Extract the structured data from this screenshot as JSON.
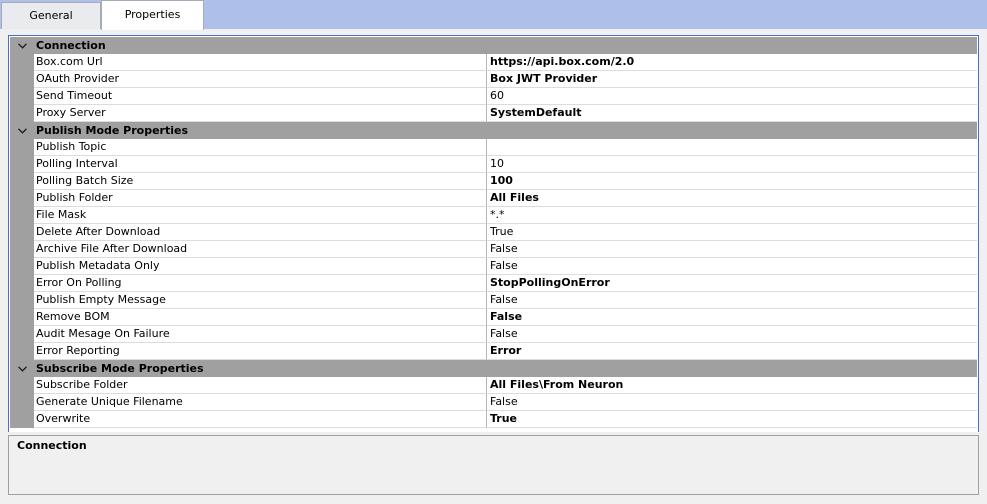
{
  "tabs": [
    {
      "label": "General",
      "active": false
    },
    {
      "label": "Properties",
      "active": true
    }
  ],
  "categories": [
    {
      "name": "Connection",
      "expanded": true,
      "properties": [
        {
          "name": "Box.com Url",
          "value": "https://api.box.com/2.0",
          "bold": true
        },
        {
          "name": "OAuth Provider",
          "value": "Box JWT Provider",
          "bold": true
        },
        {
          "name": "Send Timeout",
          "value": "60",
          "bold": false
        },
        {
          "name": "Proxy Server",
          "value": "SystemDefault",
          "bold": true
        }
      ]
    },
    {
      "name": "Publish Mode Properties",
      "expanded": true,
      "properties": [
        {
          "name": "Publish Topic",
          "value": "",
          "bold": false
        },
        {
          "name": "Polling Interval",
          "value": "10",
          "bold": false
        },
        {
          "name": "Polling Batch Size",
          "value": "100",
          "bold": true
        },
        {
          "name": "Publish Folder",
          "value": "All Files",
          "bold": true
        },
        {
          "name": "File Mask",
          "value": "*.*",
          "bold": false
        },
        {
          "name": "Delete After Download",
          "value": "True",
          "bold": false
        },
        {
          "name": "Archive File After Download",
          "value": "False",
          "bold": false
        },
        {
          "name": "Publish Metadata Only",
          "value": "False",
          "bold": false
        },
        {
          "name": "Error On Polling",
          "value": "StopPollingOnError",
          "bold": true
        },
        {
          "name": "Publish Empty Message",
          "value": "False",
          "bold": false
        },
        {
          "name": "Remove BOM",
          "value": "False",
          "bold": true
        },
        {
          "name": "Audit Mesage On Failure",
          "value": "False",
          "bold": false
        },
        {
          "name": "Error Reporting",
          "value": "Error",
          "bold": true
        }
      ]
    },
    {
      "name": "Subscribe Mode Properties",
      "expanded": true,
      "properties": [
        {
          "name": "Subscribe Folder",
          "value": "All Files\\From Neuron",
          "bold": true
        },
        {
          "name": "Generate Unique Filename",
          "value": "False",
          "bold": false
        },
        {
          "name": "Overwrite",
          "value": "True",
          "bold": true
        }
      ]
    }
  ],
  "description": {
    "title": "Connection",
    "text": ""
  },
  "colors": {
    "tabbar": "#aebfe9",
    "panel_border": "#4a6fc2",
    "category_bg": "#a0a0a0",
    "gutter_bg": "#a0a0a0"
  }
}
